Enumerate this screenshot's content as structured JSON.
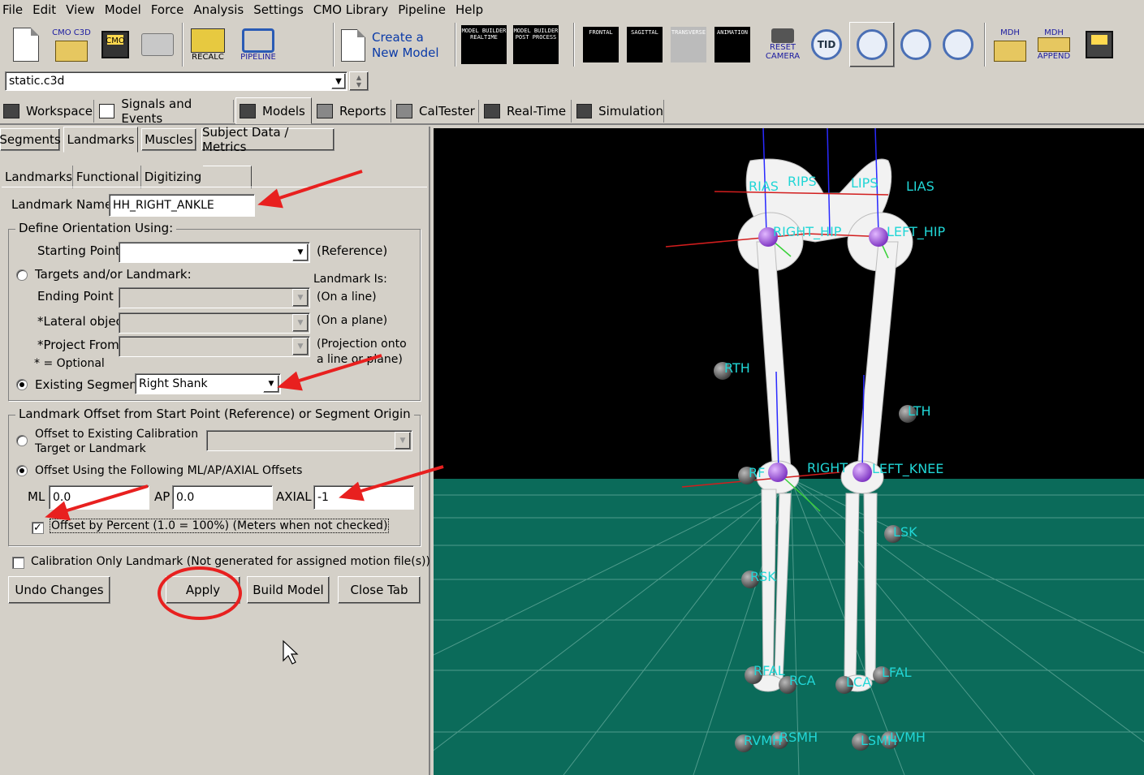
{
  "menu": [
    "File",
    "Edit",
    "View",
    "Model",
    "Force",
    "Analysis",
    "Settings",
    "CMO Library",
    "Pipeline",
    "Help"
  ],
  "toolbar": {
    "cmo_c3d": "CMO C3D",
    "cmo": "CMO",
    "recalc": "RECALC",
    "pipeline": "PIPELINE",
    "create_line1": "Create a",
    "create_line2": "New Model",
    "mb_realtime": "MODEL BUILDER REALTIME",
    "mb_post": "MODEL BUILDER POST PROCESS",
    "frontal": "FRONTAL",
    "sagittal": "SAGITTAL",
    "transverse": "TRANSVERSE",
    "animation": "ANIMATION",
    "reset_camera_1": "RESET",
    "reset_camera_2": "CAMERA",
    "tid": "TID",
    "mdh": "MDH",
    "mdh_append": "APPEND"
  },
  "file_combo": {
    "value": "static.c3d"
  },
  "main_tabs": [
    "Workspace",
    "Signals and Events",
    "Models",
    "Reports",
    "CalTester",
    "Real-Time",
    "Simulation"
  ],
  "model_tabs": [
    "Segments",
    "Landmarks",
    "Muscles",
    "Subject Data / Metrics"
  ],
  "landmark_tabs": [
    "Landmarks",
    "Functional",
    "Digitizing"
  ],
  "form": {
    "landmark_name_label": "Landmark Name:",
    "landmark_name_value": "HH_RIGHT_ANKLE",
    "orientation_title": "Define Orientation Using:",
    "starting_point_label": "Starting Point",
    "reference_label": "(Reference)",
    "targets_label": "Targets and/or Landmark:",
    "landmark_is_label": "Landmark Is:",
    "ending_point_label": "Ending Point",
    "on_line_label": "(On a line)",
    "lateral_object_label": "*Lateral object",
    "on_plane_label": "(On a plane)",
    "project_from_label": "*Project From",
    "projection_label_1": "(Projection onto",
    "projection_label_2": "a line or plane)",
    "optional_label": "* = Optional",
    "existing_segment_label": "Existing Segment",
    "existing_segment_value": "Right Shank",
    "offset_title": "Landmark Offset from Start Point (Reference) or Segment Origin",
    "offset_existing_1": "Offset to Existing Calibration",
    "offset_existing_2": "Target or Landmark",
    "offset_following": "Offset Using the Following ML/AP/AXIAL Offsets",
    "ml_label": "ML",
    "ml_value": "0.0",
    "ap_label": "AP",
    "ap_value": "0.0",
    "axial_label": "AXIAL",
    "axial_value": "-1",
    "percent_label": "Offset by Percent (1.0 = 100%) (Meters when not checked)",
    "calibration_only_label": "Calibration Only Landmark (Not generated for assigned motion file(s))"
  },
  "buttons": {
    "undo": "Undo Changes",
    "apply": "Apply",
    "build": "Build Model",
    "close": "Close Tab"
  },
  "markers": [
    "RIAS",
    "RIPS",
    "LIPS",
    "LIAS",
    "RIGHT_HIP",
    "LEFT_HIP",
    "RTH",
    "LTH",
    "RF",
    "RIGHT",
    "LEFT_KNEE",
    "LSK",
    "RSK",
    "RFAL",
    "RCA",
    "LCA",
    "LFAL",
    "RVMH",
    "RSMH",
    "LSMH",
    "LVMH"
  ],
  "colors": {
    "annotation": "#e8201f",
    "marker_label": "#21d6d6",
    "floor": "#0b6b5a",
    "sky": "#000000"
  }
}
